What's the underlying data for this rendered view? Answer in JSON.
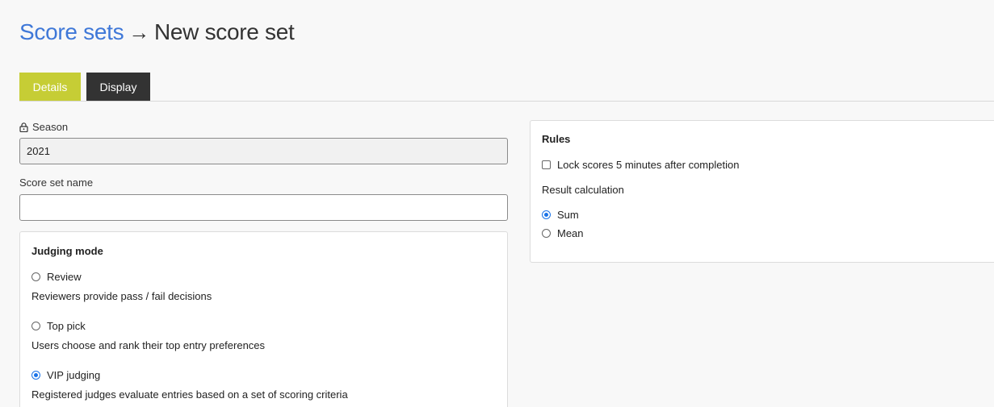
{
  "breadcrumb": {
    "parent": "Score sets",
    "arrow": "→",
    "current": "New score set"
  },
  "tabs": [
    {
      "label": "Details",
      "active": true
    },
    {
      "label": "Display",
      "active": false
    }
  ],
  "season": {
    "label": "Season",
    "value": "2021",
    "locked": true
  },
  "score_set_name": {
    "label": "Score set name",
    "value": ""
  },
  "judging_mode": {
    "title": "Judging mode",
    "options": [
      {
        "label": "Review",
        "description": "Reviewers provide pass / fail decisions",
        "selected": false
      },
      {
        "label": "Top pick",
        "description": "Users choose and rank their top entry preferences",
        "selected": false
      },
      {
        "label": "VIP judging",
        "description": "Registered judges evaluate entries based on a set of scoring criteria",
        "selected": true
      }
    ]
  },
  "rules": {
    "title": "Rules",
    "lock_scores_label": "Lock scores 5 minutes after completion",
    "lock_scores_checked": false,
    "result_calculation_label": "Result calculation",
    "result_options": [
      {
        "label": "Sum",
        "selected": true
      },
      {
        "label": "Mean",
        "selected": false
      }
    ]
  },
  "colors": {
    "link": "#3f78d8",
    "tab_active": "#c6cd35",
    "tab_inactive": "#333333",
    "radio_selected": "#1a73e8"
  }
}
